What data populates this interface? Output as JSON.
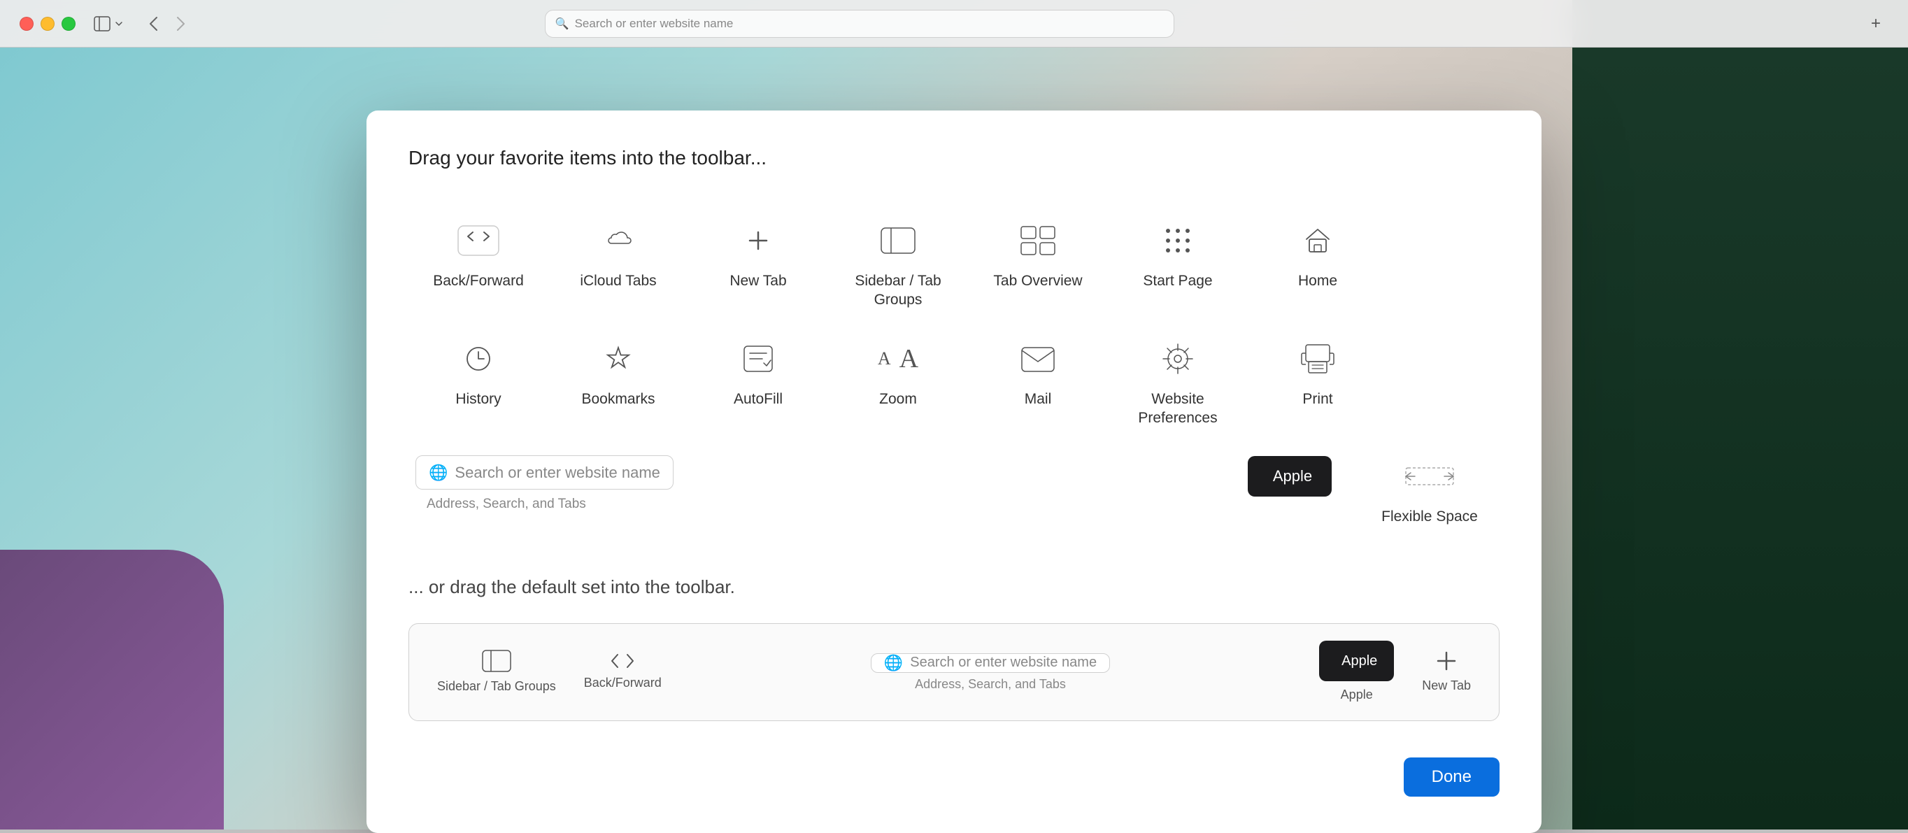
{
  "browser": {
    "search_placeholder": "Search or enter website name",
    "add_button": "+",
    "nav_back": "‹",
    "nav_forward": "›"
  },
  "modal": {
    "drag_title": "Drag your favorite items into the toolbar...",
    "default_title": "... or drag the default set into the toolbar.",
    "done_label": "Done"
  },
  "toolbar_items": [
    {
      "id": "back-forward",
      "label": "Back/Forward",
      "icon": "back_forward"
    },
    {
      "id": "icloud-tabs",
      "label": "iCloud Tabs",
      "icon": "icloud"
    },
    {
      "id": "new-tab",
      "label": "New Tab",
      "icon": "new_tab"
    },
    {
      "id": "sidebar-tab-groups",
      "label": "Sidebar / Tab Groups",
      "icon": "sidebar"
    },
    {
      "id": "tab-overview",
      "label": "Tab Overview",
      "icon": "tab_overview"
    },
    {
      "id": "start-page",
      "label": "Start Page",
      "icon": "grid"
    },
    {
      "id": "home",
      "label": "Home",
      "icon": "home"
    },
    {
      "id": "history",
      "label": "History",
      "icon": "history"
    },
    {
      "id": "bookmarks",
      "label": "Bookmarks",
      "icon": "star"
    },
    {
      "id": "autofill",
      "label": "AutoFill",
      "icon": "autofill"
    },
    {
      "id": "zoom",
      "label": "Zoom",
      "icon": "zoom"
    },
    {
      "id": "mail",
      "label": "Mail",
      "icon": "mail"
    },
    {
      "id": "website-preferences",
      "label": "Website Preferences",
      "icon": "prefs"
    },
    {
      "id": "print",
      "label": "Print",
      "icon": "print"
    },
    {
      "id": "flexible-space",
      "label": "Flexible Space",
      "icon": "flex_space"
    }
  ],
  "address_bar": {
    "placeholder": "Search or enter website name",
    "sublabel": "Address, Search, and Tabs",
    "apple_label": "Apple"
  },
  "default_toolbar": {
    "items": [
      {
        "id": "dt-sidebar",
        "label": "Sidebar / Tab Groups",
        "icon": "sidebar"
      },
      {
        "id": "dt-backfwd",
        "label": "Back/Forward",
        "icon": "back_forward_small"
      },
      {
        "id": "dt-address",
        "label": "Address, Search, and Tabs",
        "placeholder": "Search or enter website name"
      },
      {
        "id": "dt-apple",
        "label": "Apple"
      },
      {
        "id": "dt-newtab",
        "label": "New Tab",
        "icon": "new_tab"
      }
    ]
  }
}
